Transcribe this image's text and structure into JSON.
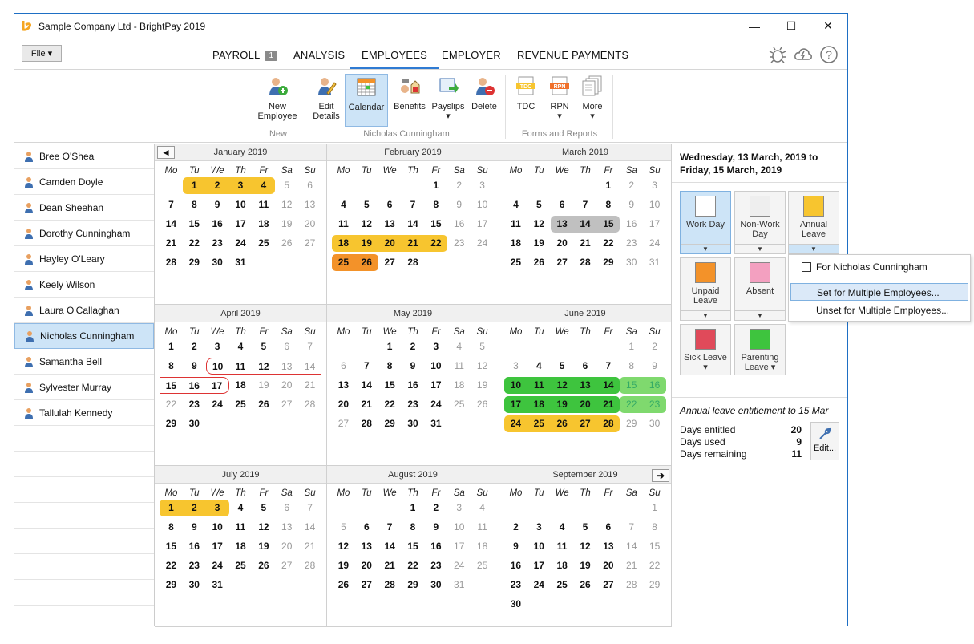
{
  "window": {
    "title": "Sample Company Ltd - BrightPay 2019"
  },
  "menu": {
    "file": "File ▾",
    "tabs": [
      {
        "label": "PAYROLL",
        "badge": "1"
      },
      {
        "label": "ANALYSIS"
      },
      {
        "label": "EMPLOYEES"
      },
      {
        "label": "EMPLOYER"
      },
      {
        "label": "REVENUE PAYMENTS"
      }
    ]
  },
  "ribbon": {
    "buttons": [
      {
        "label": "New Employee",
        "icon": "new-employee-icon"
      },
      {
        "label": "Edit Details",
        "icon": "edit-details-icon"
      },
      {
        "label": "Calendar",
        "icon": "calendar-icon"
      },
      {
        "label": "Benefits",
        "icon": "benefits-icon"
      },
      {
        "label": "Payslips",
        "icon": "payslips-icon",
        "dropdown": "▾"
      },
      {
        "label": "Delete",
        "icon": "delete-icon"
      },
      {
        "label": "TDC",
        "icon": "tdc-icon"
      },
      {
        "label": "RPN",
        "icon": "rpn-icon",
        "dropdown": "▾"
      },
      {
        "label": "More",
        "icon": "more-icon",
        "dropdown": "▾"
      }
    ],
    "groups": [
      "New",
      "Nicholas Cunningham",
      "Forms and Reports"
    ]
  },
  "employees": [
    "Bree O'Shea",
    "Camden Doyle",
    "Dean Sheehan",
    "Dorothy Cunningham",
    "Hayley O'Leary",
    "Keely Wilson",
    "Laura O'Callaghan",
    "Nicholas Cunningham",
    "Samantha Bell",
    "Sylvester Murray",
    "Tallulah Kennedy"
  ],
  "dows": [
    "Mo",
    "Tu",
    "We",
    "Th",
    "Fr",
    "Sa",
    "Su"
  ],
  "months": [
    {
      "name": "January 2019",
      "start": 1,
      "days": 31
    },
    {
      "name": "February 2019",
      "start": 4,
      "days": 28
    },
    {
      "name": "March 2019",
      "start": 4,
      "days": 31
    },
    {
      "name": "April 2019",
      "start": 0,
      "days": 30
    },
    {
      "name": "May 2019",
      "start": 2,
      "days": 31
    },
    {
      "name": "June 2019",
      "start": 5,
      "days": 30
    },
    {
      "name": "July 2019",
      "start": 0,
      "days": 31
    },
    {
      "name": "August 2019",
      "start": 3,
      "days": 31
    },
    {
      "name": "September 2019",
      "start": 6,
      "days": 30
    }
  ],
  "nav": {
    "prev": "◄",
    "next": "➔"
  },
  "side": {
    "range": "Wednesday, 13 March, 2019 to Friday, 15 March, 2019",
    "tiles": [
      {
        "label": "Work Day",
        "arrow": "▼"
      },
      {
        "label": "Non-Work Day",
        "arrow": "▼"
      },
      {
        "label": "Annual Leave",
        "arrow": "▼"
      },
      {
        "label": "Unpaid Leave",
        "arrow": "▼"
      },
      {
        "label": "Absent",
        "arrow": "▼"
      },
      {
        "label": "Sick Leave ▾"
      },
      {
        "label": "Parenting Leave ▾"
      }
    ],
    "entitlement_title": "Annual leave entitlement to 15 Mar",
    "rows": [
      {
        "label": "Days entitled",
        "value": "20"
      },
      {
        "label": "Days used",
        "value": "9"
      },
      {
        "label": "Days remaining",
        "value": "11"
      }
    ],
    "edit": "Edit..."
  },
  "popup": {
    "items": [
      "For Nicholas Cunningham",
      "Set for Multiple Employees...",
      "Unset for Multiple Employees..."
    ]
  },
  "colors": {
    "annual": "#f7c52f",
    "annual_dark": "#f39229",
    "work": "#3ec43e",
    "work_light": "#7fd96e",
    "sick": "#c0c0c0",
    "accent": "#2f7bd3"
  }
}
